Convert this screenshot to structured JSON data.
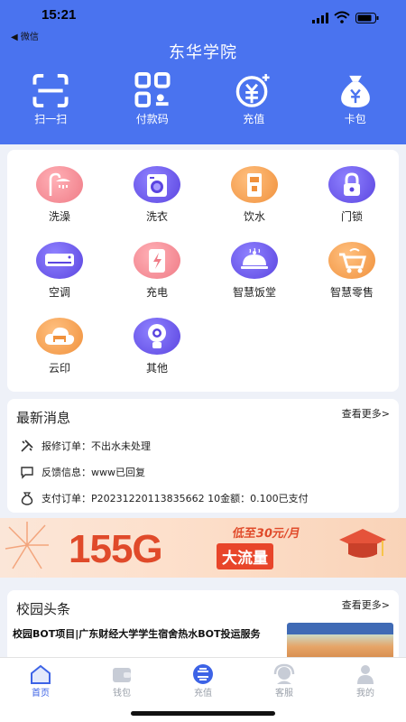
{
  "status": {
    "time": "15:21",
    "back_label": "◀ 微信"
  },
  "header": {
    "title": "东华学院"
  },
  "quick_actions": [
    {
      "label": "扫一扫",
      "icon": "scan-icon"
    },
    {
      "label": "付款码",
      "icon": "qr-code-icon"
    },
    {
      "label": "充值",
      "icon": "recharge-icon"
    },
    {
      "label": "卡包",
      "icon": "wallet-bag-icon"
    }
  ],
  "services": [
    {
      "label": "洗澡",
      "icon": "shower-icon",
      "color": "#ef7b86"
    },
    {
      "label": "洗衣",
      "icon": "washing-machine-icon",
      "color": "#6b59e6"
    },
    {
      "label": "饮水",
      "icon": "water-dispenser-icon",
      "color": "#f39a4c"
    },
    {
      "label": "门锁",
      "icon": "door-lock-icon",
      "color": "#6b59e6"
    },
    {
      "label": "空调",
      "icon": "air-conditioner-icon",
      "color": "#6b59e6"
    },
    {
      "label": "充电",
      "icon": "charging-icon",
      "color": "#ef7b86"
    },
    {
      "label": "智慧饭堂",
      "icon": "canteen-icon",
      "color": "#6b59e6"
    },
    {
      "label": "智慧零售",
      "icon": "retail-cart-icon",
      "color": "#f39a4c"
    },
    {
      "label": "云印",
      "icon": "cloud-print-icon",
      "color": "#f39a4c"
    },
    {
      "label": "其他",
      "icon": "other-icon",
      "color": "#6b59e6"
    }
  ],
  "news": {
    "title": "最新消息",
    "more": "查看更多>",
    "items": [
      {
        "label": "报修订单：",
        "text": "不出水未处理",
        "icon": "repair-tools-icon"
      },
      {
        "label": "反馈信息：",
        "text": "www已回复",
        "icon": "feedback-chat-icon"
      },
      {
        "label": "支付订单：",
        "text": "P20231220113835662 10金额：0.100已支付",
        "icon": "payment-bag-icon"
      }
    ]
  },
  "banner": {
    "big": "155G",
    "sub1": "低至30元/月",
    "sub2": "大流量"
  },
  "campus": {
    "title": "校园头条",
    "more": "查看更多>",
    "headline": "校园BOT项目|广东财经大学学生宿舍热水BOT投运服务"
  },
  "tabs": [
    {
      "label": "首页",
      "icon": "home-icon",
      "active": true
    },
    {
      "label": "钱包",
      "icon": "wallet-icon",
      "active": false
    },
    {
      "label": "充值",
      "icon": "recharge-tab-icon",
      "active": false
    },
    {
      "label": "客服",
      "icon": "customer-service-icon",
      "active": false
    },
    {
      "label": "我的",
      "icon": "profile-icon",
      "active": false
    }
  ]
}
